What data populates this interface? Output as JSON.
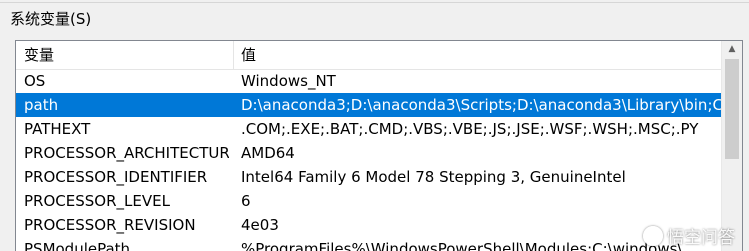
{
  "section": {
    "label": "系统变量(S)"
  },
  "table": {
    "headers": {
      "variable": "变量",
      "value": "值"
    },
    "rows": [
      {
        "variable": "OS",
        "value": "Windows_NT",
        "selected": false
      },
      {
        "variable": "path",
        "value": "D:\\anaconda3;D:\\anaconda3\\Scripts;D:\\anaconda3\\Library\\bin;C...",
        "selected": true
      },
      {
        "variable": "PATHEXT",
        "value": ".COM;.EXE;.BAT;.CMD;.VBS;.VBE;.JS;.JSE;.WSF;.WSH;.MSC;.PY",
        "selected": false
      },
      {
        "variable": "PROCESSOR_ARCHITECTURE",
        "value": "AMD64",
        "selected": false
      },
      {
        "variable": "PROCESSOR_IDENTIFIER",
        "value": "Intel64 Family 6 Model 78 Stepping 3, GenuineIntel",
        "selected": false
      },
      {
        "variable": "PROCESSOR_LEVEL",
        "value": "6",
        "selected": false
      },
      {
        "variable": "PROCESSOR_REVISION",
        "value": "4e03",
        "selected": false
      },
      {
        "variable": "PSModulePath",
        "value": "%ProgramFiles%\\WindowsPowerShell\\Modules;C:\\windows\\...",
        "selected": false
      }
    ]
  },
  "scrollbar": {
    "up_icon": "chevron-up-icon"
  },
  "watermark": {
    "text": "悟空问答",
    "logo_icon": "wukong-logo-icon"
  },
  "colors": {
    "selection": "#0078d7",
    "background": "#f0f0f0"
  }
}
